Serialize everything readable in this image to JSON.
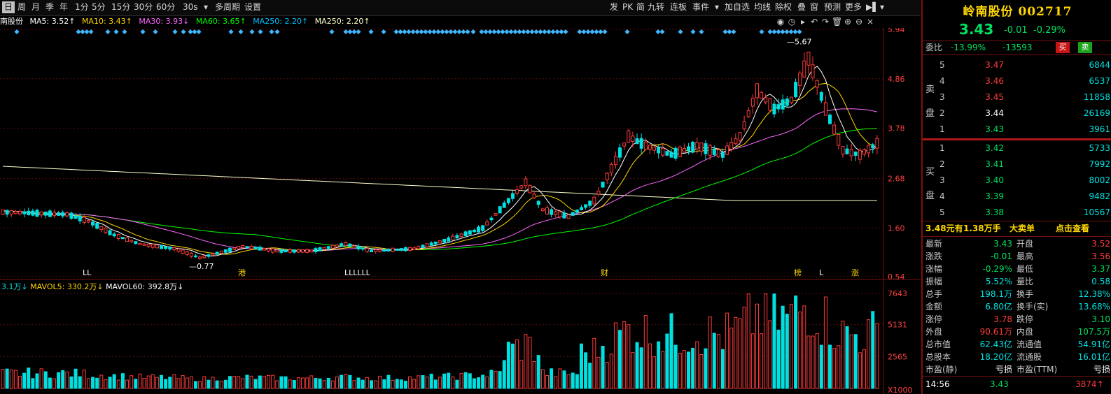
{
  "toolbar": {
    "left": [
      "日",
      "周",
      "月",
      "季",
      "年",
      "1分",
      "5分",
      "15分",
      "30分",
      "60分",
      "30s",
      "▾",
      "多周期",
      "设置"
    ],
    "right": [
      "发",
      "PK",
      "简",
      "九转",
      "连板",
      "事件",
      "▾",
      "加自选",
      "均线",
      "除权",
      "叠",
      "窗",
      "预测",
      "更多",
      "▶▌",
      "▾"
    ]
  },
  "ma_line": {
    "stock": "南股份",
    "ma5": "MA5: 3.52↑",
    "ma10": "MA10: 3.43↑",
    "ma30": "MA30: 3.93↓",
    "ma60": "MA60: 3.65↑",
    "ma250a": "MA250: 2.20↑",
    "ma250b": "MA250: 2.20↑"
  },
  "price_axis": [
    "5.94",
    "4.86",
    "3.78",
    "2.68",
    "1.60",
    "0.54"
  ],
  "volume_axis": [
    "7643",
    "5131",
    "2565",
    "X1000"
  ],
  "volume_line": {
    "vol": "3.1万↓",
    "mavol5": "MAVOL5: 330.2万↓",
    "mavol60": "MAVOL60: 392.8万↓"
  },
  "annotations": {
    "high": "5.67",
    "low": "0.77",
    "markers": [
      "LL",
      "港",
      "LLLLLL",
      "财",
      "榜",
      "L",
      "涨"
    ]
  },
  "colors": {
    "up": "#ff3b3b",
    "down": "#00e0e0",
    "ma5": "#ffffff",
    "ma10": "#ffd700",
    "ma30": "#ff66ff",
    "ma60": "#00ff00",
    "ma250": "#ffffcc"
  },
  "quote": {
    "name": "岭南股份",
    "code": "002717",
    "price": "3.43",
    "change": "-0.01",
    "pct": "-0.29%",
    "webi_label": "委比",
    "webi_pct": "-13.99%",
    "webi_val": "-13593",
    "buy_btn": "买",
    "sell_btn": "卖",
    "ask_label": "卖盘",
    "bid_label": "买盘",
    "asks": [
      {
        "lvl": "5",
        "price": "3.47",
        "vol": "6844",
        "color": "red"
      },
      {
        "lvl": "4",
        "price": "3.46",
        "vol": "6537",
        "color": "red"
      },
      {
        "lvl": "3",
        "price": "3.45",
        "vol": "11858",
        "color": "red"
      },
      {
        "lvl": "2",
        "price": "3.44",
        "vol": "26169",
        "color": "wht"
      },
      {
        "lvl": "1",
        "price": "3.43",
        "vol": "3961",
        "color": "grn"
      }
    ],
    "bids": [
      {
        "lvl": "1",
        "price": "3.42",
        "vol": "5733"
      },
      {
        "lvl": "2",
        "price": "3.41",
        "vol": "7992"
      },
      {
        "lvl": "3",
        "price": "3.40",
        "vol": "8002"
      },
      {
        "lvl": "4",
        "price": "3.39",
        "vol": "9482"
      },
      {
        "lvl": "5",
        "price": "3.38",
        "vol": "10567"
      }
    ],
    "big_order": {
      "price": "3.48元有",
      "amount": "1.38万手",
      "type": "大卖单",
      "action": "点击查看"
    },
    "stats": [
      {
        "l1": "最新",
        "v1": "3.43",
        "c1": "grn",
        "l2": "开盘",
        "v2": "3.52",
        "c2": "red"
      },
      {
        "l1": "涨跌",
        "v1": "-0.01",
        "c1": "grn",
        "l2": "最高",
        "v2": "3.56",
        "c2": "red"
      },
      {
        "l1": "涨幅",
        "v1": "-0.29%",
        "c1": "grn",
        "l2": "最低",
        "v2": "3.37",
        "c2": "grn"
      },
      {
        "l1": "振幅",
        "v1": "5.52%",
        "c1": "cy",
        "l2": "量比",
        "v2": "0.58",
        "c2": "cy"
      },
      {
        "l1": "总手",
        "v1": "198.1万",
        "c1": "cy",
        "l2": "换手",
        "v2": "12.38%",
        "c2": "cy"
      },
      {
        "l1": "金额",
        "v1": "6.80亿",
        "c1": "cy",
        "l2": "换手(实)",
        "v2": "13.68%",
        "c2": "cy"
      },
      {
        "l1": "涨停",
        "v1": "3.78",
        "c1": "red",
        "l2": "跌停",
        "v2": "3.10",
        "c2": "grn"
      },
      {
        "l1": "外盘",
        "v1": "90.61万",
        "c1": "red",
        "l2": "内盘",
        "v2": "107.5万",
        "c2": "grn"
      },
      {
        "l1": "总市值",
        "v1": "62.43亿",
        "c1": "cy",
        "l2": "流通值",
        "v2": "54.91亿",
        "c2": "cy"
      },
      {
        "l1": "总股本",
        "v1": "18.20亿",
        "c1": "cy",
        "l2": "流通股",
        "v2": "16.01亿",
        "c2": "cy"
      },
      {
        "l1": "市盈(静)",
        "v1": "亏损",
        "c1": "wht",
        "l2": "市盈(TTM)",
        "v2": "亏损",
        "c2": "wht"
      }
    ],
    "tick": {
      "time": "14:56",
      "price": "3.43",
      "vol": "3874↑"
    }
  }
}
